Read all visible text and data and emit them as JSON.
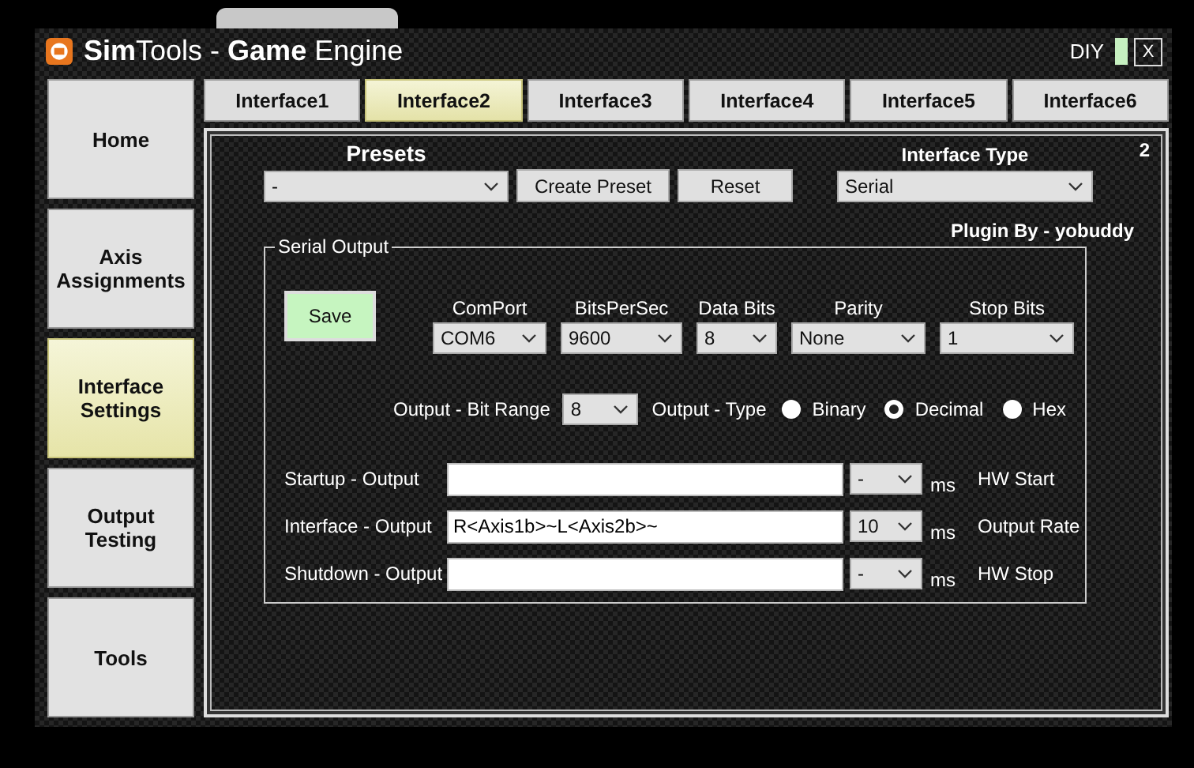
{
  "window": {
    "title": "**Sim**Tools - **Game** Engine",
    "mode": "DIY",
    "close": "X"
  },
  "sidebar": {
    "items": [
      {
        "label": "Home",
        "selected": false
      },
      {
        "label": "Axis Assignments",
        "selected": false
      },
      {
        "label": "Interface Settings",
        "selected": true
      },
      {
        "label": "Output Testing",
        "selected": false
      },
      {
        "label": "Tools",
        "selected": false
      }
    ]
  },
  "tabs": [
    {
      "label": "Interface1",
      "selected": false
    },
    {
      "label": "Interface2",
      "selected": true
    },
    {
      "label": "Interface3",
      "selected": false
    },
    {
      "label": "Interface4",
      "selected": false
    },
    {
      "label": "Interface5",
      "selected": false
    },
    {
      "label": "Interface6",
      "selected": false
    }
  ],
  "panel": {
    "number": "2",
    "presets": {
      "label": "Presets",
      "value": "-",
      "buttons": [
        "Create Preset",
        "Reset"
      ]
    },
    "interface_type": {
      "label": "Interface Type",
      "value": "Serial"
    },
    "plugin_credit": "Plugin By - yobuddy",
    "serial_output": {
      "title": "Serial Output",
      "save_button": "Save",
      "settings": [
        {
          "label": "ComPort",
          "value": "COM6"
        },
        {
          "label": "BitsPerSec",
          "value": "9600"
        },
        {
          "label": "Data Bits",
          "value": "8"
        },
        {
          "label": "Parity",
          "value": "None"
        },
        {
          "label": "Stop Bits",
          "value": "1"
        }
      ],
      "bit_range": {
        "label": "Output - Bit Range",
        "value": "8"
      },
      "output_type": {
        "label": "Output - Type",
        "options": [
          {
            "label": "Binary",
            "selected": false
          },
          {
            "label": "Decimal",
            "selected": true
          },
          {
            "label": "Hex",
            "selected": false
          }
        ]
      },
      "outputs": [
        {
          "label": "Startup - Output",
          "rate": "-",
          "unit": "ms",
          "note": "HW Start"
        },
        {
          "label": "Interface - Output",
          "value": "R<Axis1b>~L<Axis2b>~",
          "rate": "10",
          "unit": "ms",
          "note": "Output Rate"
        },
        {
          "label": "Shutdown - Output",
          "rate": "-",
          "unit": "ms",
          "note": "HW Stop"
        }
      ]
    }
  }
}
